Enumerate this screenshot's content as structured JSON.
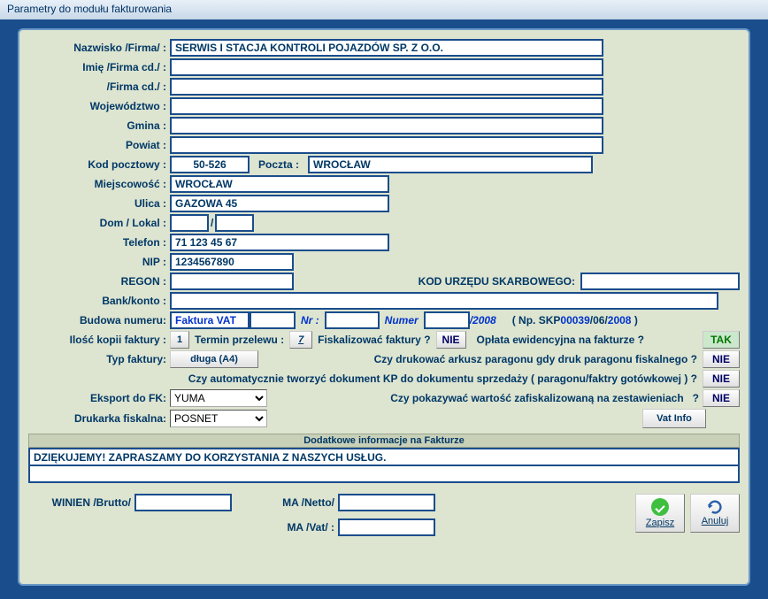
{
  "window_title": "Parametry do modułu fakturowania",
  "labels": {
    "nazwisko": "Nazwisko /Firma/ :",
    "imie": "Imię /Firma cd./ :",
    "firmacd": "/Firma cd./ :",
    "woj": "Województwo :",
    "gmina": "Gmina :",
    "powiat": "Powiat :",
    "kod": "Kod pocztowy :",
    "poczta": "Poczta :",
    "miejsc": "Miejscowość :",
    "ulica": "Ulica :",
    "domlokal": "Dom / Lokal :",
    "slash": "/",
    "telefon": "Telefon :",
    "nip": "NIP :",
    "regon": "REGON :",
    "kod_us": "KOD URZĘDU SKARBOWEGO:",
    "bank": "Bank/konto :",
    "budowa": "Budowa numeru:",
    "nr": "Nr :",
    "numer": "Numer",
    "rok": "/2008",
    "example_pre": "( Np. SKP",
    "example_num": "00039",
    "example_mid": "/06/",
    "example_yr": "2008",
    "example_post": " )",
    "ilosc_kopii": "Ilość kopii faktury :",
    "termin_przelewu": "Termin przelewu :",
    "fiskalizowac": "Fiskalizować faktury ?",
    "oplata_ewid": "Opłata ewidencyjna na fakturze ?",
    "typ_faktury": "Typ faktury:",
    "czy_drukowac": "Czy drukować arkusz paragonu gdy druk paragonu fiskalnego ?",
    "czy_auto_kp": "Czy automatycznie tworzyć dokument KP do dokumentu sprzedaży ( paragonu/faktry gotówkowej ) ?",
    "eksport_fk": "Eksport do FK:",
    "czy_pokazywac": "Czy pokazywać wartość zafiskalizowaną na zestawieniach",
    "drukarka": "Drukarka fiskalna:",
    "vat_info": "Vat Info",
    "dodatkowe": "Dodatkowe informacje na Fakturze",
    "winien": "WINIEN /Brutto/",
    "ma_netto": "MA /Netto/",
    "ma_vat": "MA /Vat/ :",
    "zapisz": "Zapisz",
    "anuluj": "Anuluj"
  },
  "values": {
    "nazwisko": "SERWIS I STACJA KONTROLI POJAZDÓW SP. Z O.O.",
    "imie": "",
    "firmacd": "",
    "woj": "",
    "gmina": "",
    "powiat": "",
    "kod": "50-526",
    "poczta": "WROCŁAW",
    "miejsc": "WROCŁAW",
    "ulica": "GAZOWA 45",
    "dom": "",
    "lokal": "",
    "telefon": "71 123 45 67",
    "nip": "1234567890",
    "regon": "",
    "kod_us": "",
    "bank": "",
    "budowa_prefix": "Faktura VAT",
    "budowa_nr": "",
    "budowa_numer": "",
    "ilosc_kopii": "1",
    "termin_przelewu": "7",
    "fiskalizowac": "NIE",
    "oplata_ewid": "TAK",
    "typ_faktury": "długa (A4)",
    "czy_drukowac": "NIE",
    "czy_auto_kp": "NIE",
    "eksport_fk": "YUMA",
    "czy_pokazywac": "NIE",
    "drukarka": "POSNET",
    "dodatkowe1": "DZIĘKUJEMY! ZAPRASZAMY DO KORZYSTANIA Z NASZYCH USŁUG.",
    "dodatkowe2": "",
    "winien": "",
    "ma_netto": "",
    "ma_vat": ""
  }
}
